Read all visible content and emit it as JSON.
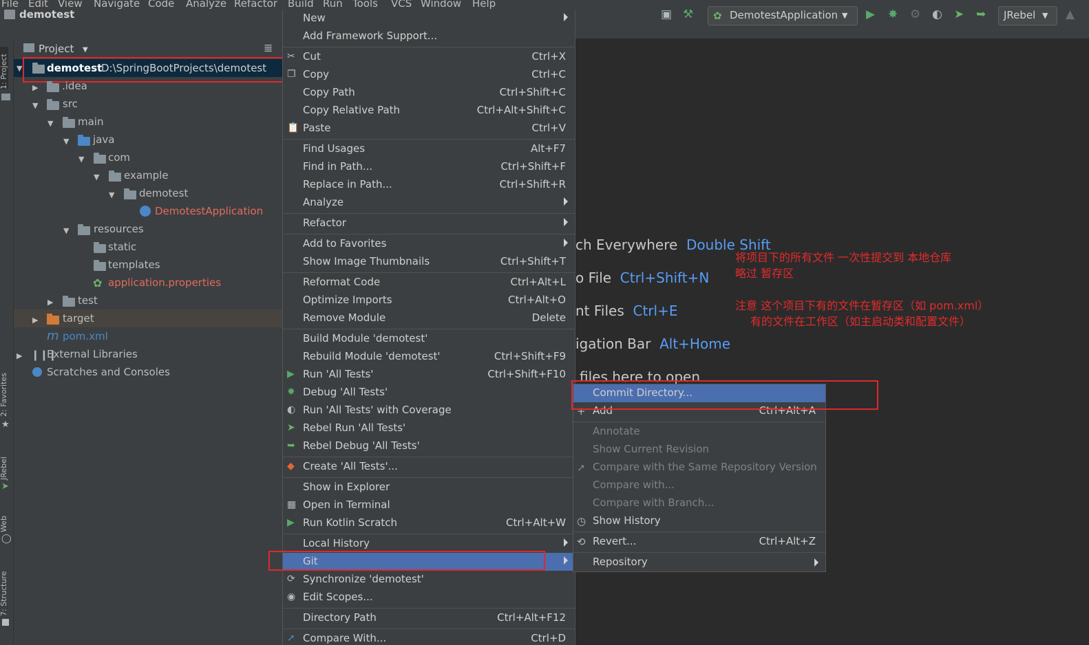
{
  "menubar": {
    "items": [
      "File",
      "Edit",
      "View",
      "Navigate",
      "Code",
      "Analyze",
      "Refactor",
      "Build",
      "Run",
      "Tools",
      "VCS",
      "Window",
      "Help"
    ]
  },
  "navbar": {
    "project_name": "demotest",
    "run_config": "DemotestApplication",
    "jrebel": "JRebel"
  },
  "sidebar": {
    "tabs": [
      "1: Project",
      "2: Favorites",
      "JRebel",
      "Web",
      "7: Structure"
    ]
  },
  "project_panel": {
    "title": "Project",
    "root": {
      "name": "demotest",
      "path": "D:\\SpringBootProjects\\demotest"
    },
    "nodes": [
      ".idea",
      "src",
      "main",
      "java",
      "com",
      "example",
      "demotest",
      "DemotestApplication",
      "resources",
      "static",
      "templates",
      "application.properties",
      "test",
      "target",
      "pom.xml",
      "External Libraries",
      "Scratches and Consoles"
    ]
  },
  "editor_hints": [
    {
      "text": "ch Everywhere",
      "key": "Double Shift"
    },
    {
      "text": "o File",
      "key": "Ctrl+Shift+N"
    },
    {
      "text": "nt Files",
      "key": "Ctrl+E"
    },
    {
      "text": "igation Bar",
      "key": "Alt+Home"
    },
    {
      "text": "files here to open",
      "key": ""
    }
  ],
  "annotations": {
    "line1": "将项目下的所有文件 一次性提交到 本地仓库",
    "line2": "略过 暂存区",
    "line3": "注意 这个项目下有的文件在暂存区（如 pom.xml）",
    "line4": "有的文件在工作区（如主启动类和配置文件）"
  },
  "context_menu": {
    "items": [
      {
        "label": "New",
        "shortcut": "",
        "submenu": true
      },
      {
        "label": "Add Framework Support...",
        "shortcut": ""
      },
      {
        "label": "Cut",
        "shortcut": "Ctrl+X",
        "icon": "scissors-icon"
      },
      {
        "label": "Copy",
        "shortcut": "Ctrl+C",
        "icon": "copy-icon"
      },
      {
        "label": "Copy Path",
        "shortcut": "Ctrl+Shift+C"
      },
      {
        "label": "Copy Relative Path",
        "shortcut": "Ctrl+Alt+Shift+C"
      },
      {
        "label": "Paste",
        "shortcut": "Ctrl+V",
        "icon": "clipboard-icon"
      },
      {
        "label": "Find Usages",
        "shortcut": "Alt+F7"
      },
      {
        "label": "Find in Path...",
        "shortcut": "Ctrl+Shift+F"
      },
      {
        "label": "Replace in Path...",
        "shortcut": "Ctrl+Shift+R"
      },
      {
        "label": "Analyze",
        "shortcut": "",
        "submenu": true
      },
      {
        "label": "Refactor",
        "shortcut": "",
        "submenu": true
      },
      {
        "label": "Add to Favorites",
        "shortcut": "",
        "submenu": true
      },
      {
        "label": "Show Image Thumbnails",
        "shortcut": "Ctrl+Shift+T"
      },
      {
        "label": "Reformat Code",
        "shortcut": "Ctrl+Alt+L"
      },
      {
        "label": "Optimize Imports",
        "shortcut": "Ctrl+Alt+O"
      },
      {
        "label": "Remove Module",
        "shortcut": "Delete"
      },
      {
        "label": "Build Module 'demotest'",
        "shortcut": ""
      },
      {
        "label": "Rebuild Module 'demotest'",
        "shortcut": "Ctrl+Shift+F9"
      },
      {
        "label": "Run 'All Tests'",
        "shortcut": "Ctrl+Shift+F10",
        "icon": "run-icon"
      },
      {
        "label": "Debug 'All Tests'",
        "shortcut": "",
        "icon": "debug-icon"
      },
      {
        "label": "Run 'All Tests' with Coverage",
        "shortcut": "",
        "icon": "coverage-icon"
      },
      {
        "label": "Rebel Run 'All Tests'",
        "shortcut": "",
        "icon": "jrebel-run-icon"
      },
      {
        "label": "Rebel Debug 'All Tests'",
        "shortcut": "",
        "icon": "jrebel-debug-icon"
      },
      {
        "label": "Create 'All Tests'...",
        "shortcut": "",
        "icon": "create-test-icon"
      },
      {
        "label": "Show in Explorer",
        "shortcut": ""
      },
      {
        "label": "Open in Terminal",
        "shortcut": "",
        "icon": "terminal-icon"
      },
      {
        "label": "Run Kotlin Scratch",
        "shortcut": "Ctrl+Alt+W",
        "icon": "run-icon"
      },
      {
        "label": "Local History",
        "shortcut": "",
        "submenu": true
      },
      {
        "label": "Git",
        "shortcut": "",
        "submenu": true,
        "active": true
      },
      {
        "label": "Synchronize 'demotest'",
        "shortcut": "",
        "icon": "sync-icon"
      },
      {
        "label": "Edit Scopes...",
        "shortcut": "",
        "icon": "scope-icon"
      },
      {
        "label": "Directory Path",
        "shortcut": "Ctrl+Alt+F12"
      },
      {
        "label": "Compare With...",
        "shortcut": "Ctrl+D",
        "icon": "compare-icon"
      }
    ]
  },
  "git_submenu": {
    "items": [
      {
        "label": "Commit Directory...",
        "shortcut": "",
        "active": true
      },
      {
        "label": "Add",
        "shortcut": "Ctrl+Alt+A",
        "icon": "plus-icon"
      },
      {
        "label": "Annotate",
        "shortcut": "",
        "disabled": true
      },
      {
        "label": "Show Current Revision",
        "shortcut": "",
        "disabled": true
      },
      {
        "label": "Compare with the Same Repository Version",
        "shortcut": "",
        "disabled": true
      },
      {
        "label": "Compare with...",
        "shortcut": "",
        "disabled": true
      },
      {
        "label": "Compare with Branch...",
        "shortcut": "",
        "disabled": true
      },
      {
        "label": "Show History",
        "shortcut": "",
        "icon": "history-icon"
      },
      {
        "label": "Revert...",
        "shortcut": "Ctrl+Alt+Z",
        "icon": "revert-icon"
      },
      {
        "label": "Repository",
        "shortcut": "",
        "submenu": true
      }
    ]
  },
  "colors": {
    "background": "#2b2b2b",
    "panel": "#3c3f41",
    "selection": "#4b6eaf",
    "highlight_box": "#e0282e",
    "shortcut_blue": "#589df6",
    "annotation_red": "#e52b2b"
  }
}
